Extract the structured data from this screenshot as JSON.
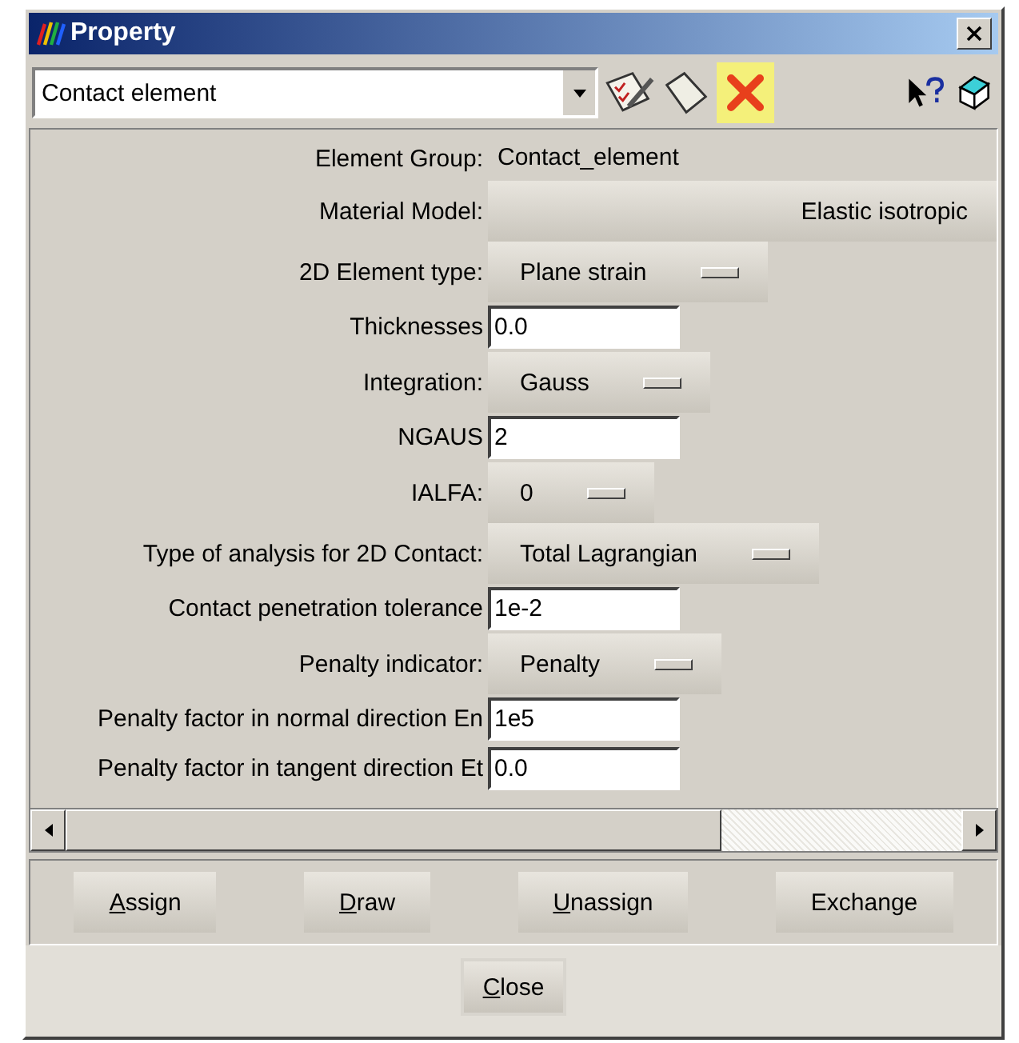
{
  "window": {
    "title": "Property"
  },
  "toolbar": {
    "combo_value": "Contact element"
  },
  "rows": [
    {
      "kind": "static",
      "label": "Element Group:",
      "value": "Contact_element"
    },
    {
      "kind": "wide",
      "label": "Material Model:",
      "value": "Elastic isotropic"
    },
    {
      "kind": "option",
      "label": "2D Element type:",
      "value": "Plane strain"
    },
    {
      "kind": "input",
      "label": "Thicknesses",
      "value": "0.0"
    },
    {
      "kind": "option",
      "label": "Integration:",
      "value": "Gauss"
    },
    {
      "kind": "input",
      "label": "NGAUS",
      "value": "2"
    },
    {
      "kind": "option",
      "label": "IALFA:",
      "value": "0"
    },
    {
      "kind": "option",
      "label": "Type of analysis for 2D Contact:",
      "value": "Total Lagrangian"
    },
    {
      "kind": "input",
      "label": "Contact penetration tolerance",
      "value": "1e-2"
    },
    {
      "kind": "option",
      "label": "Penalty indicator:",
      "value": "Penalty"
    },
    {
      "kind": "input",
      "label": "Penalty factor in normal direction En",
      "value": "1e5"
    },
    {
      "kind": "input",
      "label": "Penalty factor in tangent direction Et",
      "value": "0.0"
    }
  ],
  "actions": [
    {
      "label": "Assign",
      "mnemonic_first": true
    },
    {
      "label": "Draw",
      "mnemonic_first": true
    },
    {
      "label": "Unassign",
      "mnemonic_first": true
    },
    {
      "label": "Exchange",
      "mnemonic_first": false
    }
  ],
  "close_button": {
    "label": "Close",
    "mnemonic_first": true
  }
}
